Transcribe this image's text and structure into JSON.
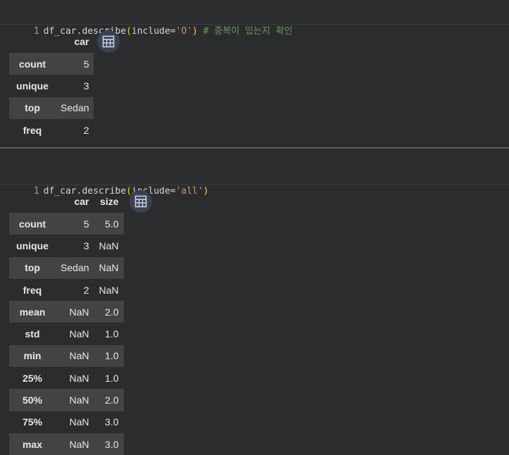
{
  "cells": [
    {
      "line_number": "1",
      "code": {
        "prefix": "df_car.describe",
        "open": "(",
        "arg_name": "include=",
        "arg_value": "'O'",
        "close": ")",
        "comment": " # 중복이 있는지 확인"
      },
      "table": {
        "columns": [
          "car"
        ],
        "rows": [
          {
            "index": "count",
            "values": [
              "5"
            ]
          },
          {
            "index": "unique",
            "values": [
              "3"
            ]
          },
          {
            "index": "top",
            "values": [
              "Sedan"
            ]
          },
          {
            "index": "freq",
            "values": [
              "2"
            ]
          }
        ]
      }
    },
    {
      "line_number": "1",
      "code": {
        "prefix": "df_car.describe",
        "open": "(",
        "arg_name": "include=",
        "arg_value": "'all'",
        "close": ")",
        "comment": ""
      },
      "table": {
        "columns": [
          "car",
          "size"
        ],
        "rows": [
          {
            "index": "count",
            "values": [
              "5",
              "5.0"
            ]
          },
          {
            "index": "unique",
            "values": [
              "3",
              "NaN"
            ]
          },
          {
            "index": "top",
            "values": [
              "Sedan",
              "NaN"
            ]
          },
          {
            "index": "freq",
            "values": [
              "2",
              "NaN"
            ]
          },
          {
            "index": "mean",
            "values": [
              "NaN",
              "2.0"
            ]
          },
          {
            "index": "std",
            "values": [
              "NaN",
              "1.0"
            ]
          },
          {
            "index": "min",
            "values": [
              "NaN",
              "1.0"
            ]
          },
          {
            "index": "25%",
            "values": [
              "NaN",
              "1.0"
            ]
          },
          {
            "index": "50%",
            "values": [
              "NaN",
              "2.0"
            ]
          },
          {
            "index": "75%",
            "values": [
              "NaN",
              "3.0"
            ]
          },
          {
            "index": "max",
            "values": [
              "NaN",
              "3.0"
            ]
          }
        ]
      }
    }
  ],
  "icons": {
    "table_button": "table-grid-icon"
  },
  "colors": {
    "background": "#2b2c2e",
    "row_stripe": "#424345",
    "button_bg": "#3b4150"
  }
}
